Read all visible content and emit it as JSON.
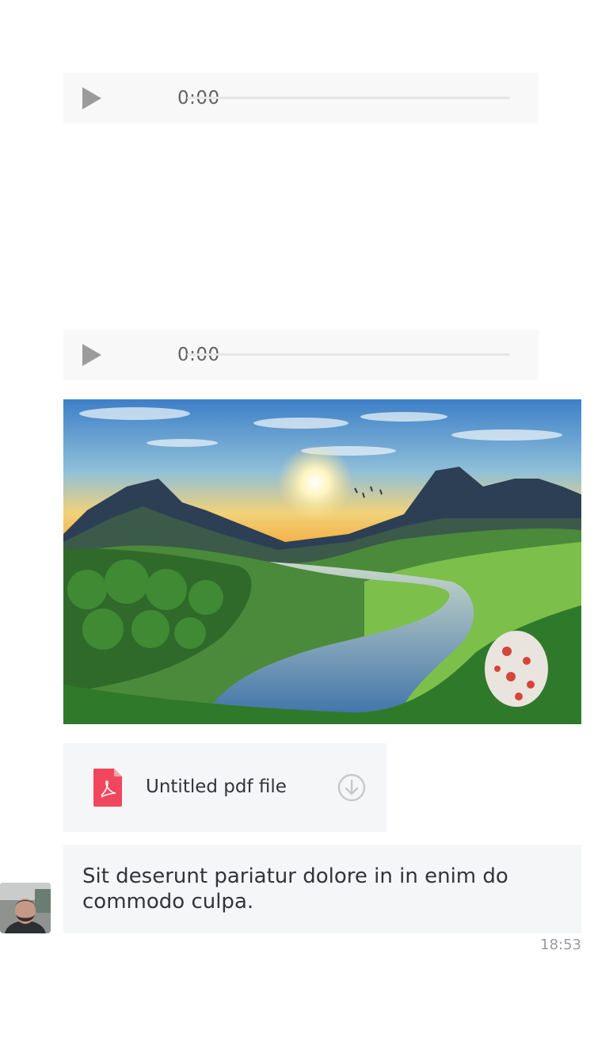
{
  "messages": {
    "audio1": {
      "time": "0:00",
      "icon": "play-icon"
    },
    "audio2": {
      "time": "0:00",
      "icon": "play-icon"
    },
    "image": {
      "description": ""
    },
    "file": {
      "name": "Untitled pdf file",
      "icon": "pdf-icon",
      "action_icon": "download-icon"
    },
    "text": {
      "body": "Sit deserunt pariatur dolore in in enim do commodo culpa.",
      "timestamp": "18:53"
    }
  },
  "colors": {
    "bubble": "#f5f6f8",
    "audio_bg": "#f8f8f8",
    "pdf_red": "#f0475e",
    "text": "#33343a",
    "muted": "#9a9ba0"
  }
}
